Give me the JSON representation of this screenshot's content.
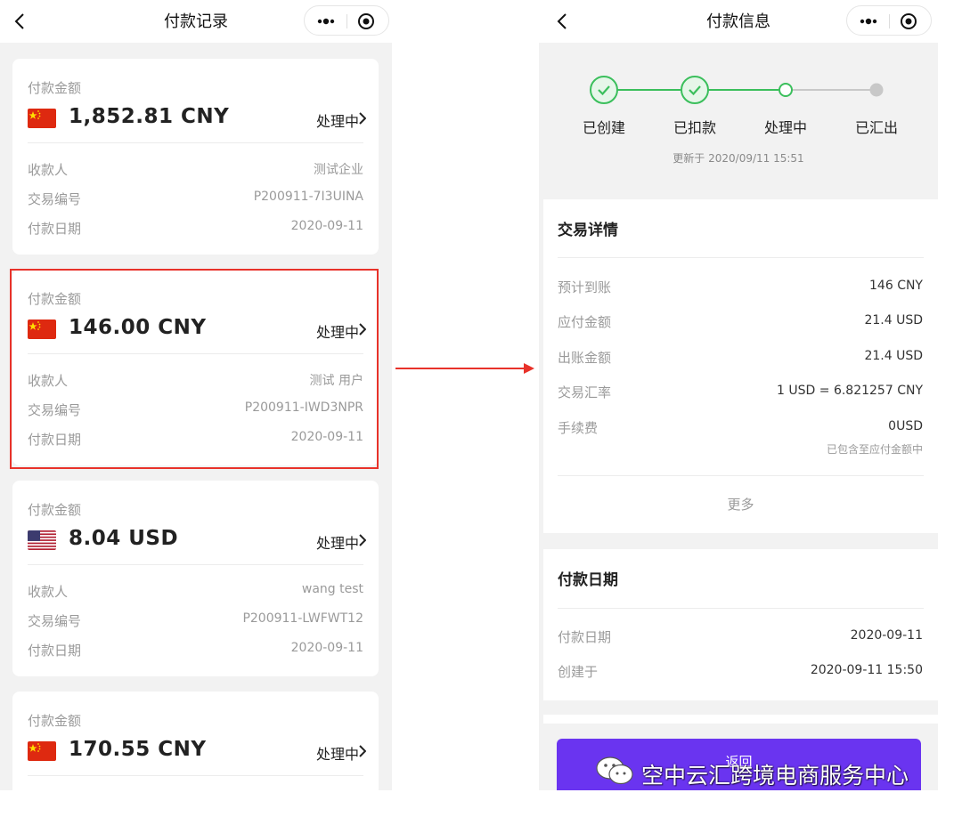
{
  "left": {
    "nav_title": "付款记录",
    "cards": [
      {
        "amount_label": "付款金额",
        "amount": "1,852.81 CNY",
        "currency": "CNY",
        "status": "处理中",
        "payee_label": "收款人",
        "payee": "测试企业",
        "txn_label": "交易编号",
        "txn": "P200911-7I3UINA",
        "date_label": "付款日期",
        "date": "2020-09-11"
      },
      {
        "amount_label": "付款金额",
        "amount": "146.00 CNY",
        "currency": "CNY",
        "status": "处理中",
        "payee_label": "收款人",
        "payee": "测试 用户",
        "txn_label": "交易编号",
        "txn": "P200911-IWD3NPR",
        "date_label": "付款日期",
        "date": "2020-09-11"
      },
      {
        "amount_label": "付款金额",
        "amount": "8.04 USD",
        "currency": "USD",
        "status": "处理中",
        "payee_label": "收款人",
        "payee": "wang test",
        "txn_label": "交易编号",
        "txn": "P200911-LWFWT12",
        "date_label": "付款日期",
        "date": "2020-09-11"
      },
      {
        "amount_label": "付款金额",
        "amount": "170.55 CNY",
        "currency": "CNY",
        "status": "处理中"
      }
    ]
  },
  "right": {
    "nav_title": "付款信息",
    "steps": [
      {
        "label": "已创建",
        "state": "done"
      },
      {
        "label": "已扣款",
        "state": "done"
      },
      {
        "label": "处理中",
        "state": "current"
      },
      {
        "label": "已汇出",
        "state": "pending"
      }
    ],
    "updated": "更新于 2020/09/11 15:51",
    "details": {
      "title": "交易详情",
      "rows": [
        {
          "label": "预计到账",
          "value": "146 CNY"
        },
        {
          "label": "应付金额",
          "value": "21.4 USD"
        },
        {
          "label": "出账金额",
          "value": "21.4 USD"
        },
        {
          "label": "交易汇率",
          "value": "1 USD = 6.821257 CNY"
        },
        {
          "label": "手续费",
          "value": "0USD"
        }
      ],
      "fee_note": "已包含至应付金额中",
      "more": "更多"
    },
    "payment_date": {
      "title": "付款日期",
      "rows": [
        {
          "label": "付款日期",
          "value": "2020-09-11"
        },
        {
          "label": "创建于",
          "value": "2020-09-11 15:50"
        }
      ]
    },
    "button": "返回"
  },
  "watermark": "空中云汇跨境电商服务中心",
  "colors": {
    "accent_green": "#3bbf5c",
    "button_purple": "#6a34f0",
    "highlight_red": "#e8322a"
  }
}
